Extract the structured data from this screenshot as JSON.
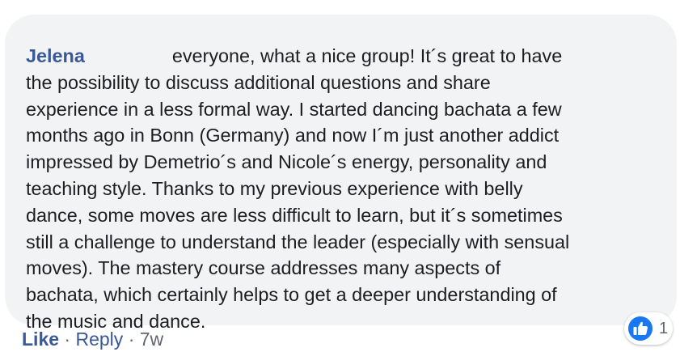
{
  "comment": {
    "author": "Jelena",
    "lines": [
      "everyone, what a nice group! It´s great to have",
      "the possibility to discuss additional questions and share",
      "experience in a less formal way. I started dancing bachata a few",
      "months ago in Bonn (Germany) and now I´m just another addict",
      "impressed by Demetrio´s and Nicole´s energy, personality and",
      "teaching style. Thanks to my previous experience with belly",
      "dance, some moves are less difficult to learn, but it´s sometimes",
      "still a challenge to understand the leader (especially with sensual",
      "moves). The mastery course addresses many aspects of",
      "bachata, which certainly helps to get a deeper understanding of",
      "the music and dance."
    ]
  },
  "reactions": {
    "icon": "like-icon",
    "count": "1",
    "color": "#1877f2"
  },
  "actions": {
    "like": "Like",
    "separator": "·",
    "reply": "Reply",
    "timestamp": "7w"
  },
  "colors": {
    "bubble": "#f2f3f5",
    "link": "#385898",
    "text": "#1c1e21",
    "meta": "#606770"
  }
}
